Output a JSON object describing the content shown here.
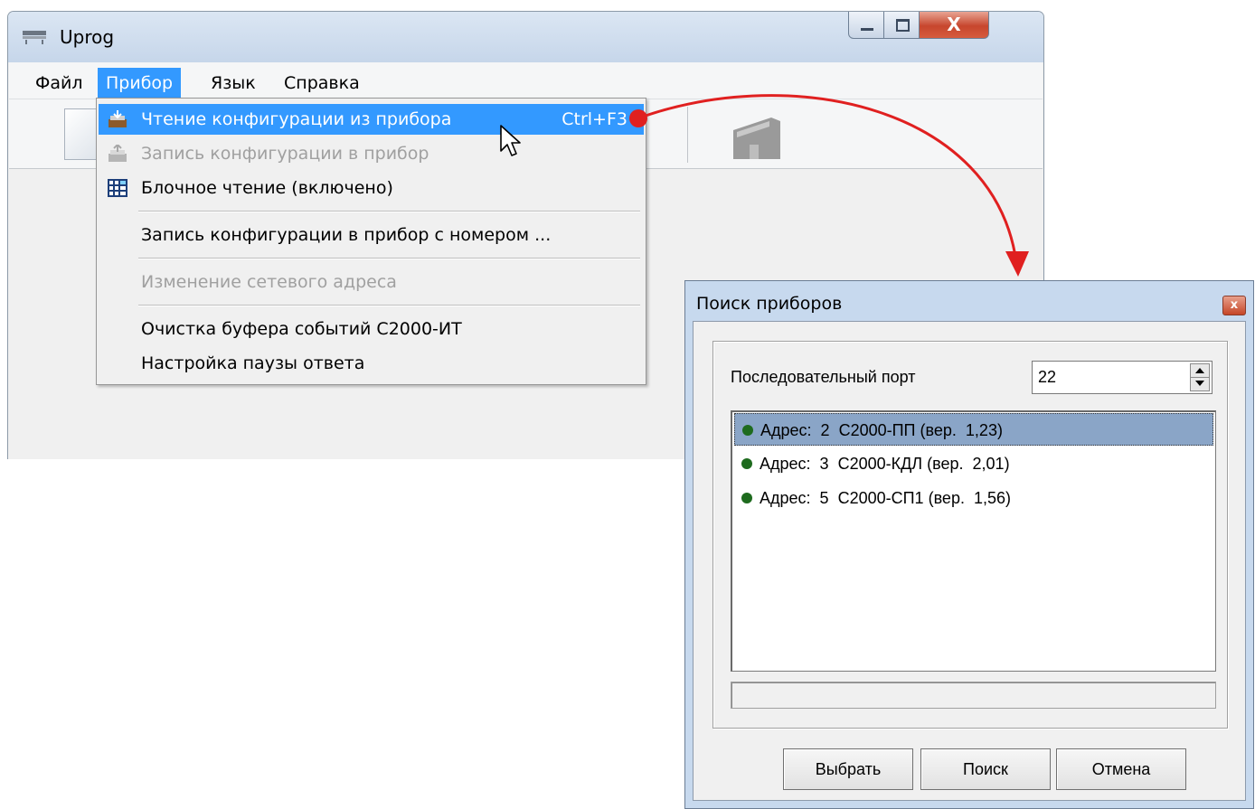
{
  "main_window": {
    "title": "Uprog",
    "menu": [
      "Файл",
      "Прибор",
      "Язык",
      "Справка"
    ],
    "active_menu_index": 1
  },
  "dropdown": {
    "items": [
      {
        "label": "Чтение конфигурации из прибора",
        "shortcut": "Ctrl+F3",
        "icon": "read-config-icon",
        "state": "highlighted"
      },
      {
        "label": "Запись конфигурации в прибор",
        "icon": "write-config-icon",
        "state": "disabled"
      },
      {
        "label": "Блочное чтение (включено)",
        "icon": "block-read-icon",
        "state": "enabled"
      },
      {
        "label": "Запись конфигурации в прибор с номером ...",
        "state": "enabled"
      },
      {
        "label": "Изменение сетевого адреса",
        "state": "disabled"
      },
      {
        "label": "Очистка буфера событий С2000-ИТ",
        "state": "enabled"
      },
      {
        "label": "Настройка паузы ответа",
        "state": "enabled"
      }
    ]
  },
  "dialog": {
    "title": "Поиск приборов",
    "port_label": "Последовательный порт",
    "port_value": "22",
    "devices": [
      {
        "address_label": "Адрес:",
        "address": "2",
        "name": "С2000-ПП",
        "version_label": "(вер.",
        "version": "1,23)",
        "selected": true
      },
      {
        "address_label": "Адрес:",
        "address": "3",
        "name": "С2000-КДЛ",
        "version_label": "(вер.",
        "version": "2,01)",
        "selected": false
      },
      {
        "address_label": "Адрес:",
        "address": "5",
        "name": "С2000-СП1",
        "version_label": "(вер.",
        "version": "1,56)",
        "selected": false
      }
    ],
    "status_text": "",
    "buttons": {
      "select": "Выбрать",
      "search": "Поиск",
      "cancel": "Отмена"
    }
  },
  "colors": {
    "highlight": "#3399ff",
    "selected_row": "#8aa5c7",
    "annotation_arrow": "#e02020",
    "status_dot": "#1e6b1e"
  }
}
